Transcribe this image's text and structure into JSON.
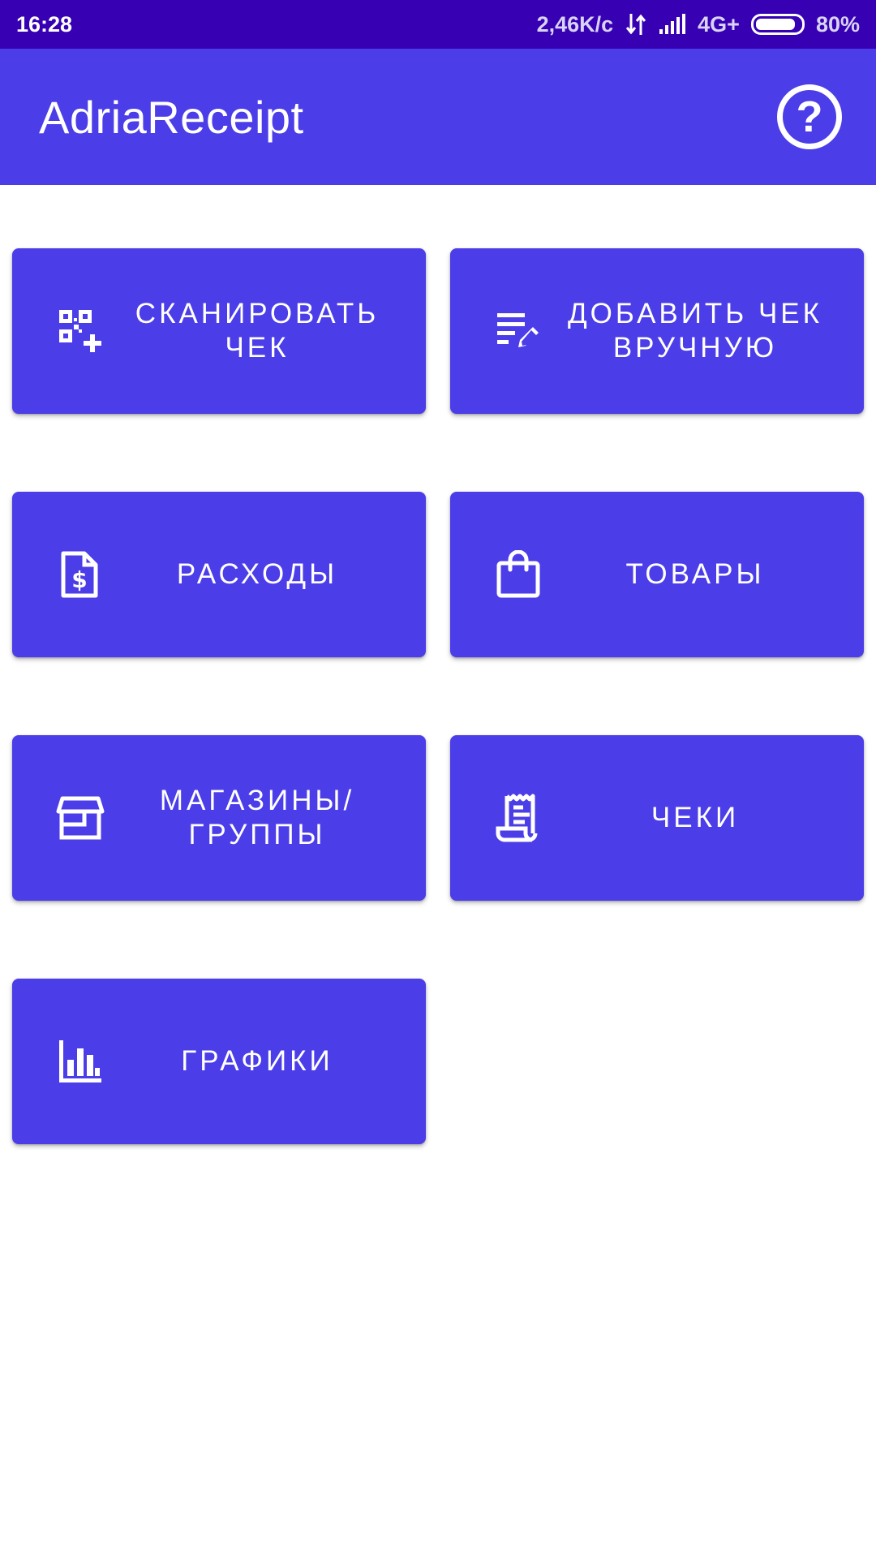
{
  "status_bar": {
    "time": "16:28",
    "net_speed": "2,46K/c",
    "network": "4G+",
    "battery": "80%"
  },
  "app_bar": {
    "title": "AdriaReceipt",
    "help_icon": "help-circle-icon"
  },
  "tiles": [
    {
      "label": "СКАНИРОВАТЬ\nЧЕК",
      "icon": "qr-add-icon"
    },
    {
      "label": "ДОБАВИТЬ ЧЕК\nВРУЧНУЮ",
      "icon": "edit-list-icon"
    },
    {
      "label": "РАСХОДЫ",
      "icon": "dollar-document-icon"
    },
    {
      "label": "ТОВАРЫ",
      "icon": "shopping-bag-icon"
    },
    {
      "label": "МАГАЗИНЫ/\nГРУППЫ",
      "icon": "store-icon"
    },
    {
      "label": "ЧЕКИ",
      "icon": "receipt-icon"
    },
    {
      "label": "ГРАФИКИ",
      "icon": "bar-chart-icon"
    }
  ],
  "colors": {
    "status_bar": "#3700b3",
    "primary": "#4b3de8",
    "on_primary": "#ffffff"
  }
}
